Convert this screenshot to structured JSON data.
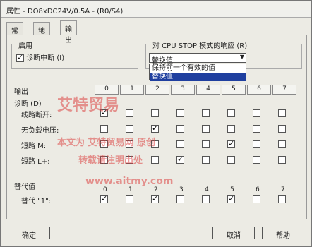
{
  "window": {
    "title": "属性 - DO8xDC24V/0.5A - (R0/S4)"
  },
  "tabs": [
    {
      "label": "常规"
    },
    {
      "label": "地址"
    },
    {
      "label": "输出"
    }
  ],
  "enable_group": {
    "title": "启用",
    "diag_interrupt_label": "诊断中断 (I)",
    "diag_interrupt_checked": true
  },
  "cpu_stop_group": {
    "title": "对 CPU STOP 模式的响应 (R)",
    "selected": "替换值",
    "options": [
      "保持前一个有效的值",
      "替换值"
    ]
  },
  "table": {
    "header_label": "输出",
    "columns": [
      "0",
      "1",
      "2",
      "3",
      "4",
      "5",
      "6",
      "7"
    ],
    "diag_label": "诊断 (D)",
    "rows": [
      {
        "label": "线路断开:",
        "checked": [
          true,
          false,
          false,
          false,
          false,
          false,
          false,
          false
        ]
      },
      {
        "label": "无负载电压:",
        "checked": [
          false,
          false,
          true,
          false,
          false,
          false,
          false,
          false
        ]
      },
      {
        "label": "短路 M:",
        "checked": [
          false,
          false,
          false,
          false,
          false,
          true,
          false,
          false
        ]
      },
      {
        "label": "短路 L+:",
        "checked": [
          false,
          false,
          false,
          true,
          false,
          false,
          false,
          false
        ]
      }
    ]
  },
  "substitute": {
    "group_label": "替代值",
    "row_label": "替代 \"1\":",
    "columns": [
      "0",
      "1",
      "2",
      "3",
      "4",
      "5",
      "6",
      "7"
    ],
    "checked": [
      true,
      false,
      true,
      false,
      false,
      true,
      false,
      false
    ]
  },
  "buttons": {
    "ok": "确定",
    "cancel": "取消",
    "help": "帮助"
  },
  "watermark": {
    "line1": "艾特贸易",
    "line2": "本文为 艾特贸易网 原创",
    "line3": "转载请注明出处",
    "url": "www.aitmy.com"
  }
}
